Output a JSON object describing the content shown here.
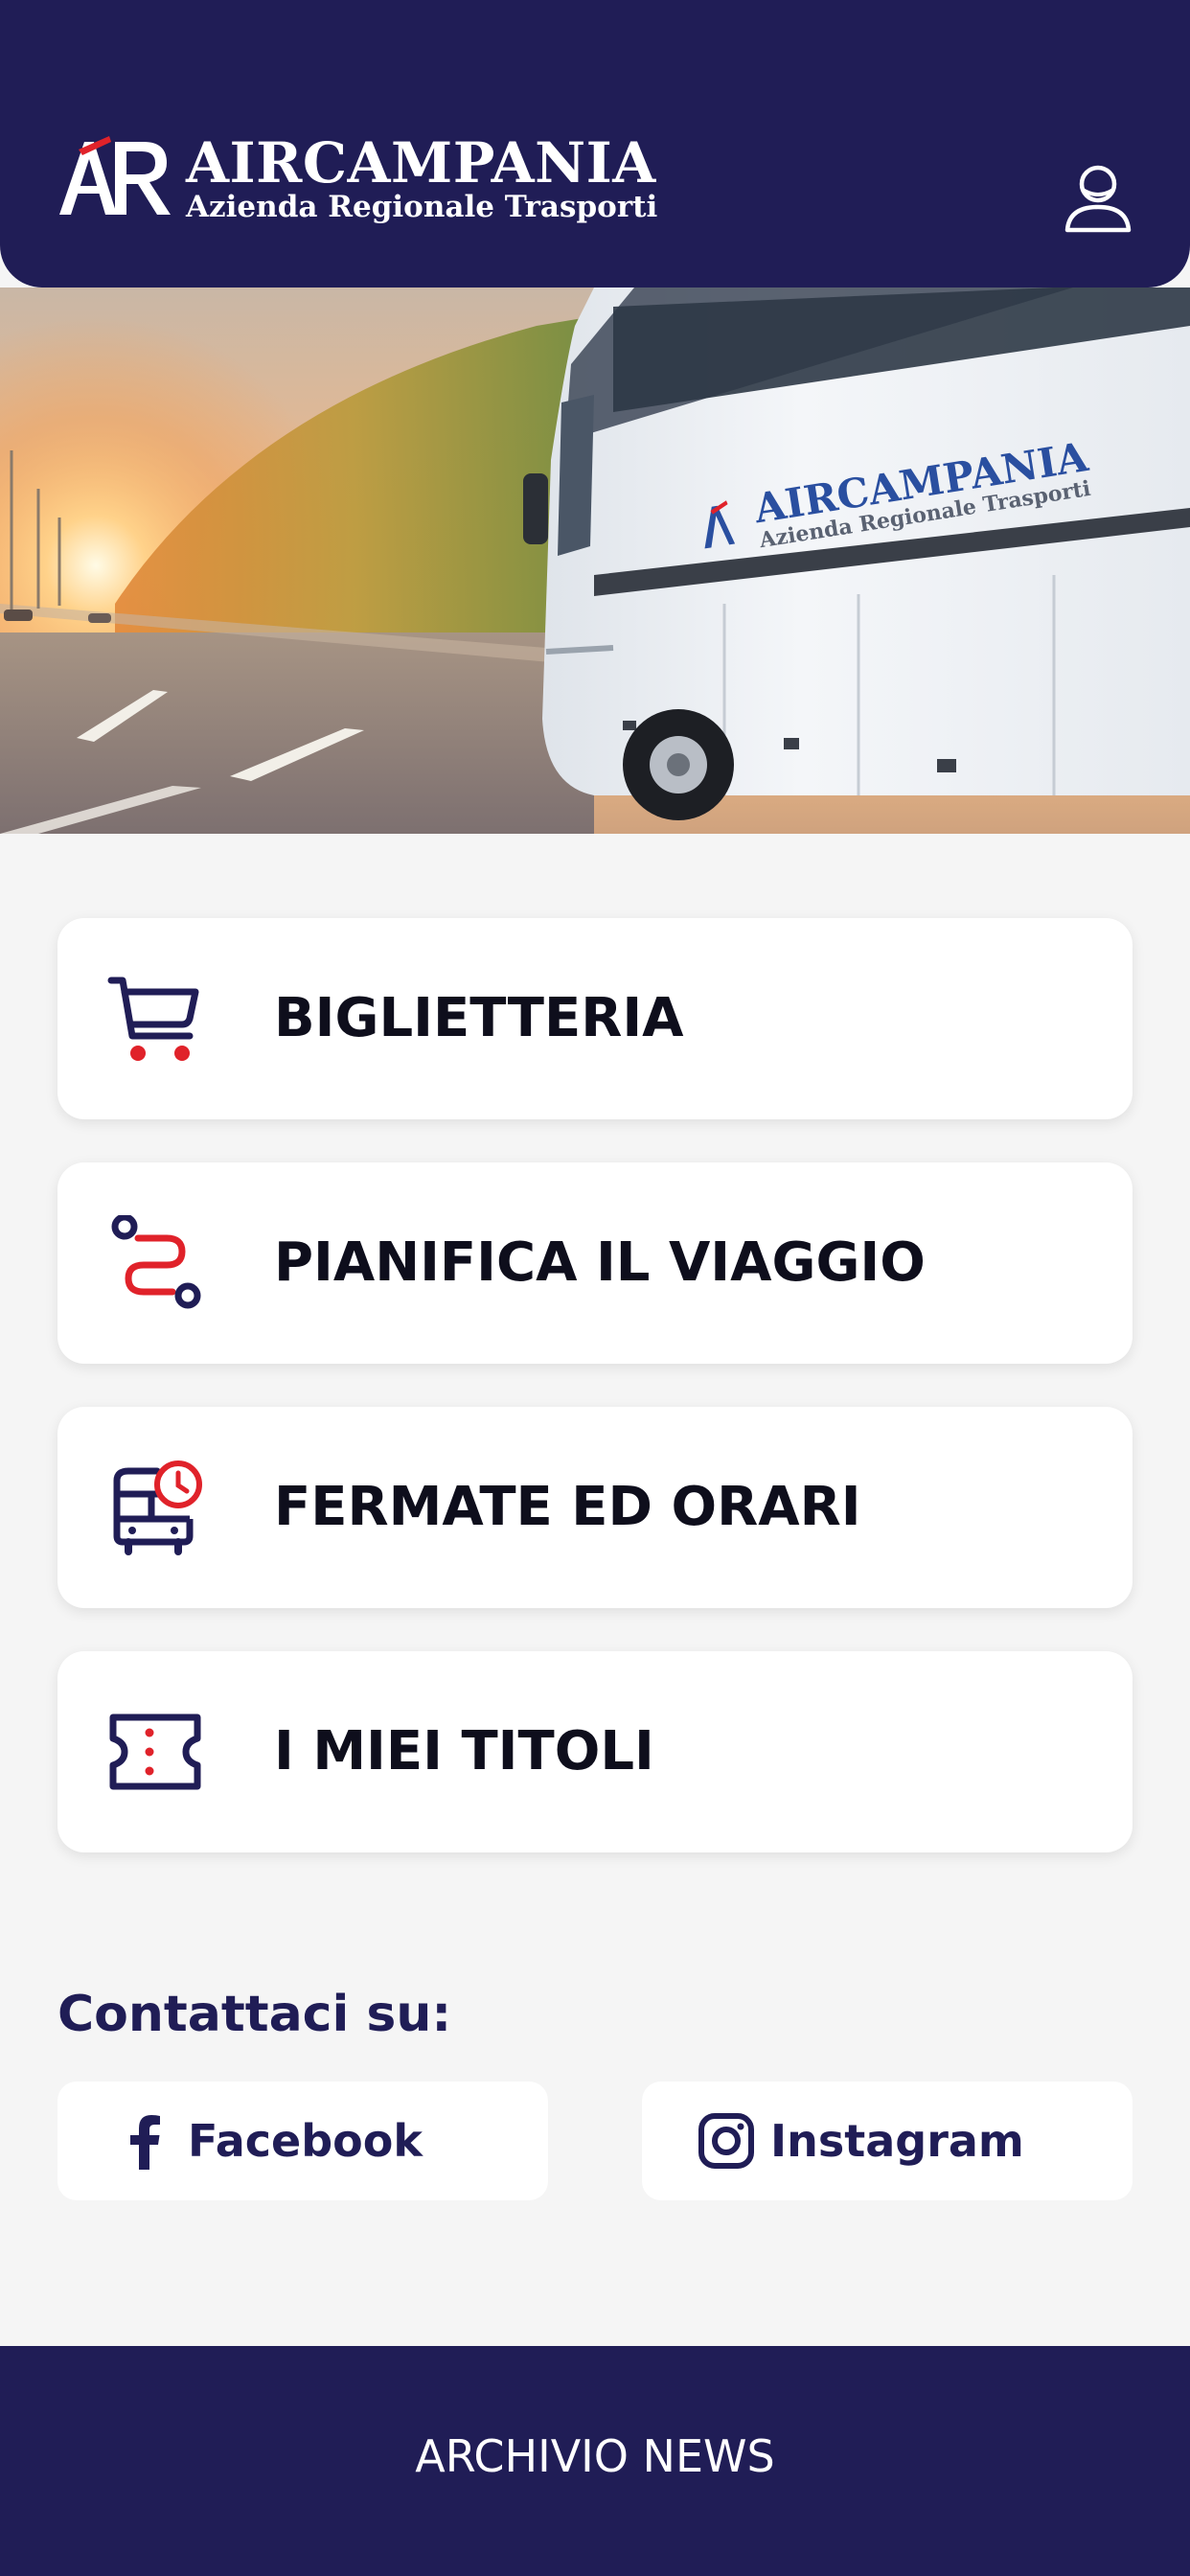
{
  "colors": {
    "brand_navy": "#201d56",
    "accent_red": "#e0222a",
    "page_background": "#f5f5f5",
    "card_background": "#ffffff"
  },
  "header": {
    "logo_name": "AIRCAMPANIA",
    "logo_subtitle": "Azienda Regionale Trasporti",
    "user_icon": "user-icon"
  },
  "hero": {
    "bus_brand_name": "AIRCAMPANIA",
    "bus_brand_subtitle": "Azienda Regionale Trasporti"
  },
  "menu": [
    {
      "label": "BIGLIETTERIA",
      "icon": "cart-icon"
    },
    {
      "label": "PIANIFICA IL VIAGGIO",
      "icon": "route-icon"
    },
    {
      "label": "FERMATE ED ORARI",
      "icon": "bus-clock-icon"
    },
    {
      "label": "I MIEI TITOLI",
      "icon": "ticket-icon"
    }
  ],
  "contact": {
    "title": "Contattaci su:",
    "facebook": {
      "label": "Facebook",
      "icon": "facebook-icon"
    },
    "instagram": {
      "label": "Instagram",
      "icon": "instagram-icon"
    }
  },
  "footer": {
    "label": "ARCHIVIO NEWS"
  }
}
